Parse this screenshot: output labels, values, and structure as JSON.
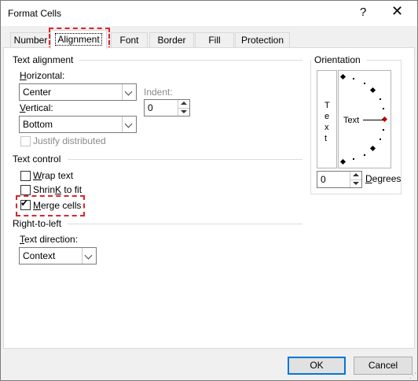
{
  "window": {
    "title": "Format Cells",
    "help_label": "?",
    "close_label": "✕"
  },
  "tabs": [
    {
      "label": "Number"
    },
    {
      "label": "Alignment"
    },
    {
      "label": "Font"
    },
    {
      "label": "Border"
    },
    {
      "label": "Fill"
    },
    {
      "label": "Protection"
    }
  ],
  "active_tab": "Alignment",
  "text_alignment": {
    "section_label": "Text alignment",
    "horizontal_label_u": "H",
    "horizontal_label_rest": "orizontal:",
    "horizontal_value": "Center",
    "vertical_label_u": "V",
    "vertical_label_rest": "ertical:",
    "vertical_value": "Bottom",
    "indent_label": "Indent:",
    "indent_value": "0",
    "justify_label": "Justify distributed",
    "justify_checked": false
  },
  "text_control": {
    "section_label": "Text control",
    "wrap_u": "W",
    "wrap_rest": "rap text",
    "wrap_checked": false,
    "shrink_u": "K",
    "shrink_pre": "Shrin",
    "shrink_rest": " to fit",
    "shrink_checked": false,
    "merge_u": "M",
    "merge_rest": "erge cells",
    "merge_checked": true
  },
  "rtl": {
    "section_label": "Right-to-left",
    "direction_label_u": "T",
    "direction_label_rest": "ext direction:",
    "direction_value": "Context"
  },
  "orientation": {
    "section_label": "Orientation",
    "vertical_text": [
      "T",
      "e",
      "x",
      "t"
    ],
    "dial_label": "Text",
    "degrees_value": "0",
    "degrees_label_u": "D",
    "degrees_label_rest": "egrees"
  },
  "buttons": {
    "ok": "OK",
    "cancel": "Cancel"
  },
  "colors": {
    "highlight": "#d9272e",
    "default_button_border": "#0078d7",
    "dial_pointer": "#c00000"
  }
}
